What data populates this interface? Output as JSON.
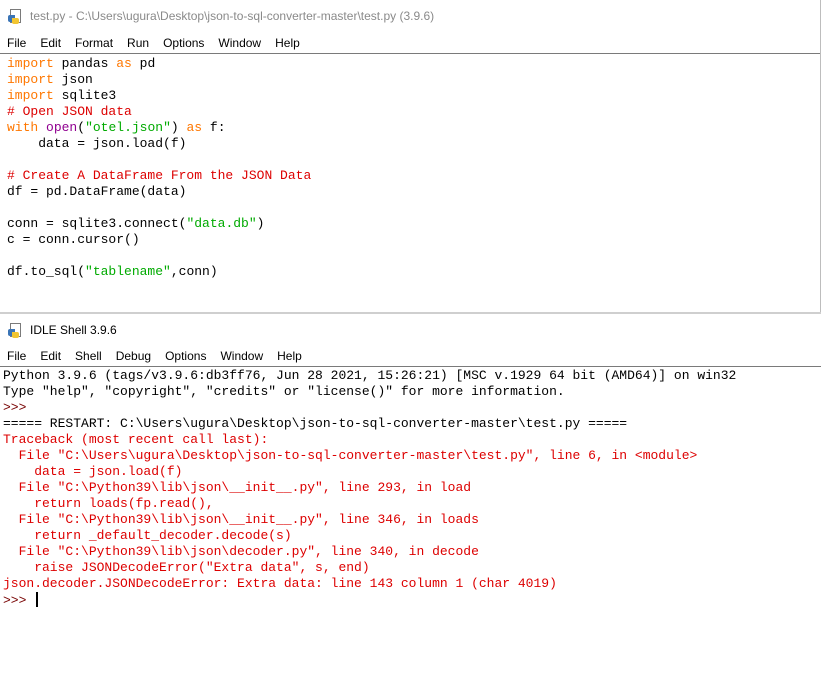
{
  "editor": {
    "title": "test.py - C:\\Users\\ugura\\Desktop\\json-to-sql-converter-master\\test.py (3.9.6)",
    "menu": [
      "File",
      "Edit",
      "Format",
      "Run",
      "Options",
      "Window",
      "Help"
    ],
    "lines": [
      [
        {
          "t": "import",
          "c": "kw"
        },
        {
          "t": " pandas ",
          "c": "nm"
        },
        {
          "t": "as",
          "c": "kw"
        },
        {
          "t": " pd",
          "c": "nm"
        }
      ],
      [
        {
          "t": "import",
          "c": "kw"
        },
        {
          "t": " json",
          "c": "nm"
        }
      ],
      [
        {
          "t": "import",
          "c": "kw"
        },
        {
          "t": " sqlite3",
          "c": "nm"
        }
      ],
      [
        {
          "t": "# Open JSON data",
          "c": "com"
        }
      ],
      [
        {
          "t": "with",
          "c": "kw"
        },
        {
          "t": " ",
          "c": "nm"
        },
        {
          "t": "open",
          "c": "bi"
        },
        {
          "t": "(",
          "c": "nm"
        },
        {
          "t": "\"otel.json\"",
          "c": "str"
        },
        {
          "t": ") ",
          "c": "nm"
        },
        {
          "t": "as",
          "c": "kw"
        },
        {
          "t": " f:",
          "c": "nm"
        }
      ],
      [
        {
          "t": "    data = json.load(f)",
          "c": "nm"
        }
      ],
      [
        {
          "t": "",
          "c": "nm"
        }
      ],
      [
        {
          "t": "# Create A DataFrame From the JSON Data",
          "c": "com"
        }
      ],
      [
        {
          "t": "df = pd.DataFrame(data)",
          "c": "nm"
        }
      ],
      [
        {
          "t": "",
          "c": "nm"
        }
      ],
      [
        {
          "t": "conn = sqlite3.connect(",
          "c": "nm"
        },
        {
          "t": "\"data.db\"",
          "c": "str"
        },
        {
          "t": ")",
          "c": "nm"
        }
      ],
      [
        {
          "t": "c = conn.cursor()",
          "c": "nm"
        }
      ],
      [
        {
          "t": "",
          "c": "nm"
        }
      ],
      [
        {
          "t": "df.to_sql(",
          "c": "nm"
        },
        {
          "t": "\"tablename\"",
          "c": "str"
        },
        {
          "t": ",conn)",
          "c": "nm"
        }
      ]
    ]
  },
  "shell": {
    "title": "IDLE Shell 3.9.6",
    "menu": [
      "File",
      "Edit",
      "Shell",
      "Debug",
      "Options",
      "Window",
      "Help"
    ],
    "lines": [
      [
        {
          "t": "Python 3.9.6 (tags/v3.9.6:db3ff76, Jun 28 2021, 15:26:21) [MSC v.1929 64 bit (AMD64)] on win32",
          "c": "nm"
        }
      ],
      [
        {
          "t": "Type \"help\", \"copyright\", \"credits\" or \"license()\" for more information.",
          "c": "nm"
        }
      ],
      [
        {
          "t": ">>> ",
          "c": "prompt"
        }
      ],
      [
        {
          "t": "===== RESTART: C:\\Users\\ugura\\Desktop\\json-to-sql-converter-master\\test.py =====",
          "c": "nm"
        }
      ],
      [
        {
          "t": "Traceback (most recent call last):",
          "c": "err"
        }
      ],
      [
        {
          "t": "  File \"C:\\Users\\ugura\\Desktop\\json-to-sql-converter-master\\test.py\", line 6, in <module>",
          "c": "err"
        }
      ],
      [
        {
          "t": "    data = json.load(f)",
          "c": "err"
        }
      ],
      [
        {
          "t": "  File \"C:\\Python39\\lib\\json\\__init__.py\", line 293, in load",
          "c": "err"
        }
      ],
      [
        {
          "t": "    return loads(fp.read(),",
          "c": "err"
        }
      ],
      [
        {
          "t": "  File \"C:\\Python39\\lib\\json\\__init__.py\", line 346, in loads",
          "c": "err"
        }
      ],
      [
        {
          "t": "    return _default_decoder.decode(s)",
          "c": "err"
        }
      ],
      [
        {
          "t": "  File \"C:\\Python39\\lib\\json\\decoder.py\", line 340, in decode",
          "c": "err"
        }
      ],
      [
        {
          "t": "    raise JSONDecodeError(\"Extra data\", s, end)",
          "c": "err"
        }
      ],
      [
        {
          "t": "json.decoder.JSONDecodeError: Extra data: line 143 column 1 (char 4019)",
          "c": "err"
        }
      ],
      [
        {
          "t": ">>> ",
          "c": "prompt"
        }
      ]
    ]
  },
  "colors": {
    "keyword": "#ff7700",
    "builtin": "#900090",
    "string": "#00aa00",
    "comment": "#dd0000",
    "error": "#dd0000",
    "prompt": "#770000"
  }
}
